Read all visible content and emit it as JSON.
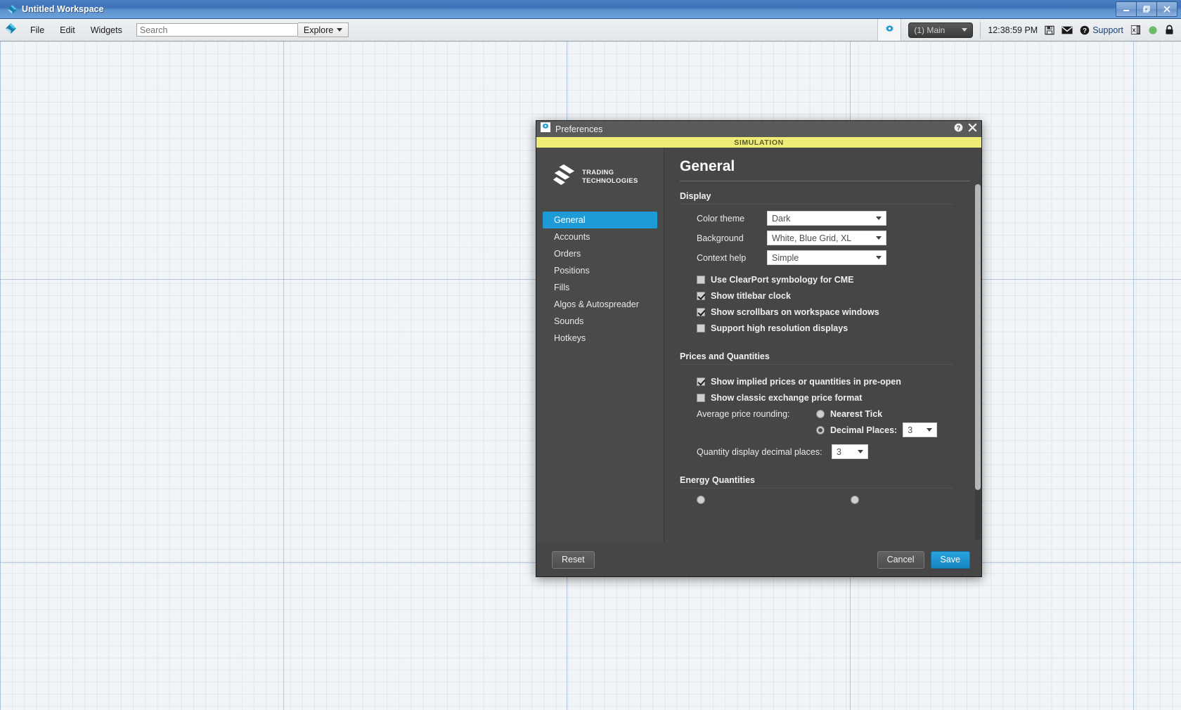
{
  "os_window": {
    "title": "Untitled Workspace",
    "icon": "tt-diamond-icon",
    "buttons": {
      "minimize": "–",
      "restore": "❐",
      "close": "✕"
    }
  },
  "toolbar": {
    "menus": [
      "File",
      "Edit",
      "Widgets"
    ],
    "search": {
      "placeholder": "Search",
      "value": ""
    },
    "explore_label": "Explore",
    "gear_icon": "gear-icon",
    "workspace_select": "(1) Main",
    "clock": "12:38:59 PM",
    "icons": [
      "save-icon",
      "mail-icon",
      "help-icon",
      "excel-icon",
      "status-online-icon",
      "lock-icon"
    ],
    "support_label": "Support"
  },
  "dialog": {
    "title": "Preferences",
    "help_icon": "help-icon",
    "close_icon": "close-icon",
    "banner": "SIMULATION",
    "brand": {
      "line1": "TRADING",
      "line2": "TECHNOLOGIES",
      "logo": "tt-logo-icon"
    },
    "sidebar": [
      {
        "label": "General",
        "active": true
      },
      {
        "label": "Accounts",
        "active": false
      },
      {
        "label": "Orders",
        "active": false
      },
      {
        "label": "Positions",
        "active": false
      },
      {
        "label": "Fills",
        "active": false
      },
      {
        "label": "Algos & Autospreader",
        "active": false
      },
      {
        "label": "Sounds",
        "active": false
      },
      {
        "label": "Hotkeys",
        "active": false
      }
    ],
    "page_title": "General",
    "sections": {
      "display": {
        "heading": "Display",
        "color_theme": {
          "label": "Color theme",
          "value": "Dark"
        },
        "background": {
          "label": "Background",
          "value": "White, Blue Grid, XL"
        },
        "context_help": {
          "label": "Context help",
          "value": "Simple"
        },
        "checkboxes": [
          {
            "label": "Use ClearPort symbology for CME",
            "checked": false
          },
          {
            "label": "Show titlebar clock",
            "checked": true
          },
          {
            "label": "Show scrollbars on workspace windows",
            "checked": true
          },
          {
            "label": "Support high resolution displays",
            "checked": false
          }
        ]
      },
      "prices": {
        "heading": "Prices and Quantities",
        "checkboxes": [
          {
            "label": "Show implied prices or quantities in pre-open",
            "checked": true
          },
          {
            "label": "Show classic exchange price format",
            "checked": false
          }
        ],
        "avg_rounding_label": "Average price rounding:",
        "radio_nearest_tick": {
          "label": "Nearest Tick",
          "selected": false
        },
        "radio_decimal_places": {
          "label": "Decimal Places:",
          "selected": true,
          "value": "3"
        },
        "qty_decimal_label": "Quantity display decimal places:",
        "qty_decimal_value": "3"
      },
      "energy": {
        "heading": "Energy Quantities"
      }
    },
    "footer": {
      "reset": "Reset",
      "cancel": "Cancel",
      "save": "Save"
    }
  },
  "colors": {
    "accent_blue": "#1e9ad6",
    "dialog_bg": "#464646",
    "sidebar_bg": "#4a4a4a",
    "banner_yellow": "#eeee77",
    "titlebar_blue": "#4a7fc1"
  }
}
